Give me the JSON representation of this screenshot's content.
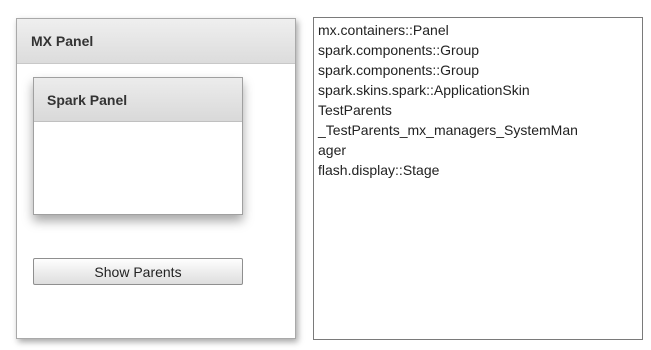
{
  "mx_panel": {
    "title": "MX Panel",
    "spark_panel": {
      "title": "Spark Panel"
    },
    "show_parents_label": "Show Parents"
  },
  "output": {
    "lines": [
      "mx.containers::Panel",
      "spark.components::Group",
      "spark.components::Group",
      "spark.skins.spark::ApplicationSkin",
      "TestParents",
      "_TestParents_mx_managers_SystemMan",
      "ager",
      "flash.display::Stage"
    ]
  }
}
